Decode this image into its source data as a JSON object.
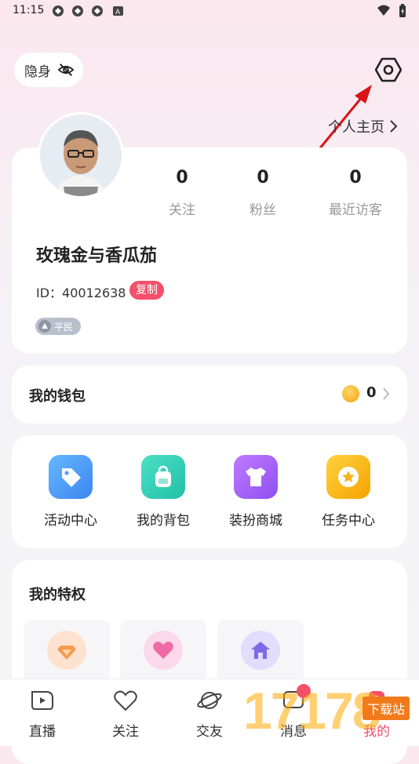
{
  "status_bar": {
    "time": "11:15",
    "notif_icons": [
      "app-icon",
      "app-icon",
      "app-icon",
      "a-icon"
    ]
  },
  "stealth": {
    "label": "隐身",
    "icon": "eye-off-icon"
  },
  "header": {
    "home_link": "个人主页"
  },
  "profile": {
    "name": "玫瑰金与香瓜茄",
    "id_text": "ID：40012638",
    "copy_label": "复制",
    "rank_label": "平民",
    "stats": [
      {
        "value": "0",
        "label": "关注"
      },
      {
        "value": "0",
        "label": "粉丝"
      },
      {
        "value": "0",
        "label": "最近访客"
      }
    ]
  },
  "wallet": {
    "title": "我的钱包",
    "balance": "0"
  },
  "features": [
    {
      "label": "活动中心",
      "icon": "tag-icon",
      "color": "#4a9bf5"
    },
    {
      "label": "我的背包",
      "icon": "backpack-icon",
      "color": "#2fc9b0"
    },
    {
      "label": "装扮商城",
      "icon": "shirt-icon",
      "color": "#a660f0"
    },
    {
      "label": "任务中心",
      "icon": "star-badge-icon",
      "color": "#f7b21e"
    }
  ],
  "privileges": {
    "title": "我的特权",
    "items": [
      {
        "icon": "diamond-icon",
        "color": "#f8a76b"
      },
      {
        "icon": "heart-icon",
        "color": "#f57bb0"
      },
      {
        "icon": "house-icon",
        "color": "#8a7cf5"
      }
    ]
  },
  "tabs": [
    {
      "label": "直播",
      "icon": "live-icon"
    },
    {
      "label": "关注",
      "icon": "heart-outline-icon"
    },
    {
      "label": "交友",
      "icon": "planet-icon"
    },
    {
      "label": "消息",
      "icon": "message-icon"
    },
    {
      "label": "我的",
      "icon": "profile-icon"
    }
  ],
  "watermark": {
    "text": "17178",
    "sub": "下载站"
  }
}
